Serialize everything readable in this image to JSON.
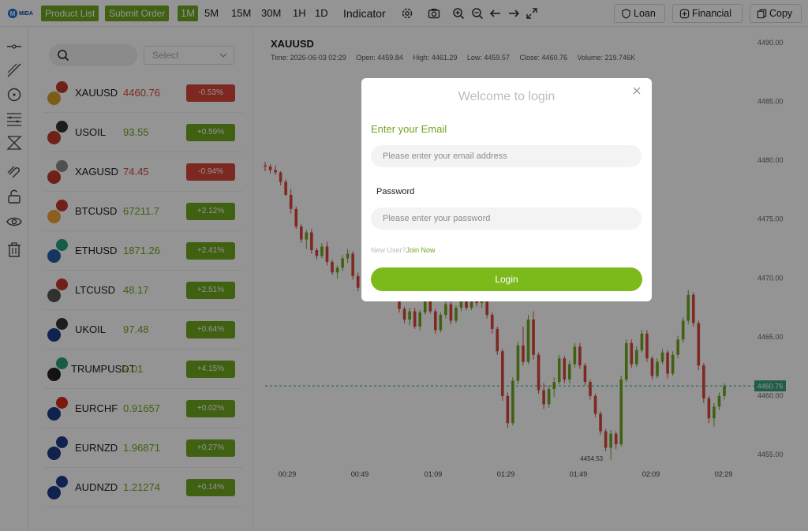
{
  "brand": {
    "logo_letter": "M",
    "logo_text": "MIDA"
  },
  "toolbar": {
    "product_list_label": "Product List",
    "submit_order_label": "Submit Order",
    "timeframes": [
      "1M",
      "5M",
      "15M",
      "30M",
      "1H",
      "1D"
    ],
    "active_timeframe": "1M",
    "indicator_label": "Indicator",
    "loan_label": "Loan",
    "financial_label": "Financial",
    "copy_label": "Copy"
  },
  "symbol_list": {
    "search_placeholder": "",
    "select_placeholder": "Select",
    "items": [
      {
        "symbol": "XAUUSD",
        "price": "4460.76",
        "change": "-0.53%",
        "dir": "dn",
        "icon_top": "us-flag-icon",
        "icon_bottom": "gold-icon",
        "c1": "#c0392b",
        "c2": "#d4a12b"
      },
      {
        "symbol": "USOIL",
        "price": "93.55",
        "change": "+0.59%",
        "dir": "up",
        "icon_top": "oil-barrel-icon",
        "icon_bottom": "us-flag-icon",
        "c1": "#333333",
        "c2": "#c0392b"
      },
      {
        "symbol": "XAGUSD",
        "price": "74.45",
        "change": "-0.94%",
        "dir": "dn",
        "icon_top": "silver-icon",
        "icon_bottom": "us-flag-icon",
        "c1": "#8a8a8a",
        "c2": "#c0392b"
      },
      {
        "symbol": "BTCUSD",
        "price": "67211.7",
        "change": "+2.12%",
        "dir": "up",
        "icon_top": "us-flag-icon",
        "icon_bottom": "bitcoin-icon",
        "c1": "#c0392b",
        "c2": "#f2a43a"
      },
      {
        "symbol": "ETHUSD",
        "price": "1871.26",
        "change": "+2.41%",
        "dir": "up",
        "icon_top": "tether-icon",
        "icon_bottom": "ethereum-icon",
        "c1": "#26a17b",
        "c2": "#2a5ca8"
      },
      {
        "symbol": "LTCUSD",
        "price": "48.17",
        "change": "+2.51%",
        "dir": "up",
        "icon_top": "us-flag-icon",
        "icon_bottom": "litecoin-icon",
        "c1": "#c0392b",
        "c2": "#555555"
      },
      {
        "symbol": "UKOIL",
        "price": "97.48",
        "change": "+0.64%",
        "dir": "up",
        "icon_top": "oil-barrel-icon",
        "icon_bottom": "uk-flag-icon",
        "c1": "#333333",
        "c2": "#1f3c88"
      },
      {
        "symbol": "TRUMPUSDT",
        "price": "2.01",
        "change": "+4.15%",
        "dir": "up",
        "icon_top": "tether-icon",
        "icon_bottom": "trump-token-icon",
        "c1": "#26a17b",
        "c2": "#222222"
      },
      {
        "symbol": "EURCHF",
        "price": "0.91657",
        "change": "+0.02%",
        "dir": "up",
        "icon_top": "swiss-flag-icon",
        "icon_bottom": "eu-flag-icon",
        "c1": "#d52b1e",
        "c2": "#1f3c88"
      },
      {
        "symbol": "EURNZD",
        "price": "1.96871",
        "change": "+0.27%",
        "dir": "up",
        "icon_top": "nz-flag-icon",
        "icon_bottom": "eu-flag-icon",
        "c1": "#1f3c88",
        "c2": "#1f3c88"
      },
      {
        "symbol": "AUDNZD",
        "price": "1.21274",
        "change": "+0.14%",
        "dir": "up",
        "icon_top": "au-flag-icon",
        "icon_bottom": "nz-flag-icon",
        "c1": "#1f3c88",
        "c2": "#1f3c88"
      }
    ]
  },
  "chart_header": {
    "symbol": "XAUUSD",
    "time": "Time: 2026-06-03 02:29",
    "open": "Open: 4459.84",
    "high": "High: 4461.29",
    "low": "Low: 4459.57",
    "close": "Close: 4460.76",
    "volume": "Volume: 219.746K"
  },
  "chart_data": {
    "type": "candlestick",
    "y_ticks": [
      "4490.00",
      "4485.00",
      "4480.00",
      "4475.00",
      "4470.00",
      "4465.00",
      "4460.00",
      "4455.00"
    ],
    "ylim": [
      4455,
      4490
    ],
    "x_ticks": [
      "00:29",
      "00:49",
      "01:09",
      "01:29",
      "01:49",
      "02:09",
      "02:29"
    ],
    "current_price": "4460.76",
    "low_marker": "4454.53",
    "candles": [
      [
        4479.5,
        4479.8,
        4479.0,
        4479.4
      ],
      [
        4479.4,
        4479.6,
        4478.8,
        4479.1
      ],
      [
        4479.1,
        4479.5,
        4478.7,
        4478.9
      ],
      [
        4478.9,
        4479.0,
        4477.8,
        4478.1
      ],
      [
        4478.1,
        4478.3,
        4476.9,
        4477.0
      ],
      [
        4477.0,
        4477.5,
        4475.4,
        4475.8
      ],
      [
        4475.8,
        4476.0,
        4474.1,
        4474.3
      ],
      [
        4474.3,
        4474.5,
        4472.9,
        4473.2
      ],
      [
        4473.2,
        4474.0,
        4472.4,
        4473.8
      ],
      [
        4473.8,
        4474.1,
        4472.0,
        4472.3
      ],
      [
        4472.3,
        4472.5,
        4471.5,
        4471.8
      ],
      [
        4471.8,
        4472.9,
        4471.6,
        4472.6
      ],
      [
        4472.6,
        4473.0,
        4471.0,
        4471.3
      ],
      [
        4471.3,
        4471.5,
        4470.2,
        4470.4
      ],
      [
        4470.4,
        4471.0,
        4469.9,
        4470.8
      ],
      [
        4470.8,
        4471.9,
        4470.5,
        4471.6
      ],
      [
        4471.6,
        4472.4,
        4471.2,
        4472.0
      ],
      [
        4472.0,
        4472.2,
        4469.8,
        4470.1
      ],
      [
        4470.1,
        4470.4,
        4468.8,
        4469.1
      ],
      [
        4469.1,
        4470.1,
        4468.5,
        4469.8
      ],
      [
        4469.8,
        4470.2,
        4468.4,
        4468.7
      ],
      [
        4468.7,
        4470.9,
        4468.5,
        4470.6
      ],
      [
        4470.6,
        4472.0,
        4470.2,
        4471.7
      ],
      [
        4471.7,
        4472.3,
        4470.7,
        4470.9
      ],
      [
        4470.9,
        4471.1,
        4469.1,
        4469.3
      ],
      [
        4469.3,
        4469.6,
        4468.0,
        4468.2
      ],
      [
        4468.2,
        4468.5,
        4467.0,
        4467.3
      ],
      [
        4467.3,
        4467.5,
        4466.1,
        4466.4
      ],
      [
        4466.4,
        4467.4,
        4465.9,
        4467.1
      ],
      [
        4467.1,
        4467.4,
        4465.6,
        4465.8
      ],
      [
        4465.8,
        4467.2,
        4465.5,
        4467.0
      ],
      [
        4467.0,
        4468.5,
        4466.8,
        4468.2
      ],
      [
        4468.2,
        4468.4,
        4466.9,
        4467.1
      ],
      [
        4467.1,
        4467.3,
        4465.2,
        4465.5
      ],
      [
        4465.5,
        4467.0,
        4465.3,
        4466.8
      ],
      [
        4466.8,
        4468.0,
        4466.5,
        4467.7
      ],
      [
        4467.7,
        4468.3,
        4466.0,
        4466.3
      ],
      [
        4466.3,
        4467.6,
        4466.1,
        4467.4
      ],
      [
        4467.4,
        4468.6,
        4467.1,
        4468.3
      ],
      [
        4468.3,
        4468.5,
        4467.2,
        4467.4
      ],
      [
        4467.4,
        4469.0,
        4467.2,
        4468.7
      ],
      [
        4468.7,
        4469.0,
        4467.5,
        4467.8
      ],
      [
        4467.8,
        4468.6,
        4467.4,
        4468.3
      ],
      [
        4468.3,
        4468.4,
        4466.5,
        4466.8
      ],
      [
        4466.8,
        4467.0,
        4465.2,
        4465.6
      ],
      [
        4465.6,
        4465.8,
        4463.4,
        4463.7
      ],
      [
        4463.7,
        4463.9,
        4459.5,
        4459.9
      ],
      [
        4459.9,
        4460.2,
        4457.2,
        4457.6
      ],
      [
        4457.6,
        4461.5,
        4457.4,
        4461.2
      ],
      [
        4461.2,
        4464.5,
        4460.9,
        4464.2
      ],
      [
        4464.2,
        4465.8,
        4462.5,
        4462.8
      ],
      [
        4462.8,
        4466.8,
        4462.6,
        4466.4
      ],
      [
        4466.4,
        4467.1,
        4463.0,
        4463.4
      ],
      [
        4463.4,
        4463.6,
        4460.1,
        4460.4
      ],
      [
        4460.4,
        4461.0,
        4458.8,
        4459.2
      ],
      [
        4459.2,
        4460.8,
        4458.9,
        4460.5
      ],
      [
        4460.5,
        4461.5,
        4459.8,
        4461.1
      ],
      [
        4461.1,
        4463.4,
        4460.9,
        4463.1
      ],
      [
        4463.1,
        4463.3,
        4461.0,
        4461.3
      ],
      [
        4461.3,
        4462.9,
        4461.0,
        4462.6
      ],
      [
        4462.6,
        4464.4,
        4462.3,
        4464.1
      ],
      [
        4464.1,
        4464.4,
        4462.2,
        4462.5
      ],
      [
        4462.5,
        4462.7,
        4460.8,
        4461.1
      ],
      [
        4461.1,
        4461.3,
        4459.6,
        4459.9
      ],
      [
        4459.9,
        4460.1,
        4458.1,
        4458.4
      ],
      [
        4458.4,
        4458.6,
        4456.6,
        4456.9
      ],
      [
        4456.9,
        4457.1,
        4455.2,
        4455.5
      ],
      [
        4455.5,
        4457.0,
        4454.5,
        4456.7
      ],
      [
        4456.7,
        4456.9,
        4455.4,
        4455.8
      ],
      [
        4455.8,
        4461.6,
        4455.6,
        4461.3
      ],
      [
        4461.3,
        4464.7,
        4461.1,
        4464.4
      ],
      [
        4464.4,
        4464.7,
        4462.3,
        4462.6
      ],
      [
        4462.6,
        4464.1,
        4462.4,
        4463.8
      ],
      [
        4463.8,
        4465.5,
        4463.6,
        4465.2
      ],
      [
        4465.2,
        4465.5,
        4462.8,
        4463.1
      ],
      [
        4463.1,
        4463.3,
        4461.3,
        4461.6
      ],
      [
        4461.6,
        4463.1,
        4461.4,
        4462.8
      ],
      [
        4462.8,
        4463.9,
        4462.6,
        4463.6
      ],
      [
        4463.6,
        4463.8,
        4461.4,
        4461.8
      ],
      [
        4461.8,
        4463.7,
        4461.6,
        4463.4
      ],
      [
        4463.4,
        4465.0,
        4463.1,
        4464.7
      ],
      [
        4464.7,
        4466.6,
        4464.4,
        4466.3
      ],
      [
        4466.3,
        4468.9,
        4466.0,
        4468.5
      ],
      [
        4468.5,
        4468.7,
        4465.8,
        4466.1
      ],
      [
        4466.1,
        4466.3,
        4462.1,
        4462.5
      ],
      [
        4462.5,
        4462.7,
        4459.3,
        4459.7
      ],
      [
        4459.7,
        4459.9,
        4457.6,
        4458.0
      ],
      [
        4458.0,
        4459.3,
        4457.3,
        4459.0
      ],
      [
        4459.0,
        4460.2,
        4458.7,
        4459.9
      ],
      [
        4459.9,
        4461.0,
        4459.6,
        4460.76
      ]
    ]
  },
  "login_modal": {
    "title": "Welcome to login",
    "email_label": "Enter your Email",
    "email_placeholder": "Please enter your email address",
    "password_label": "Password",
    "password_placeholder": "Please enter your password",
    "new_user_text": "New User?",
    "join_now_label": "Join Now",
    "login_button": "Login"
  },
  "colors": {
    "accent": "#6fa520",
    "up": "#6fa520",
    "down": "#d8463a",
    "current_price_tag": "#3aa17e"
  }
}
